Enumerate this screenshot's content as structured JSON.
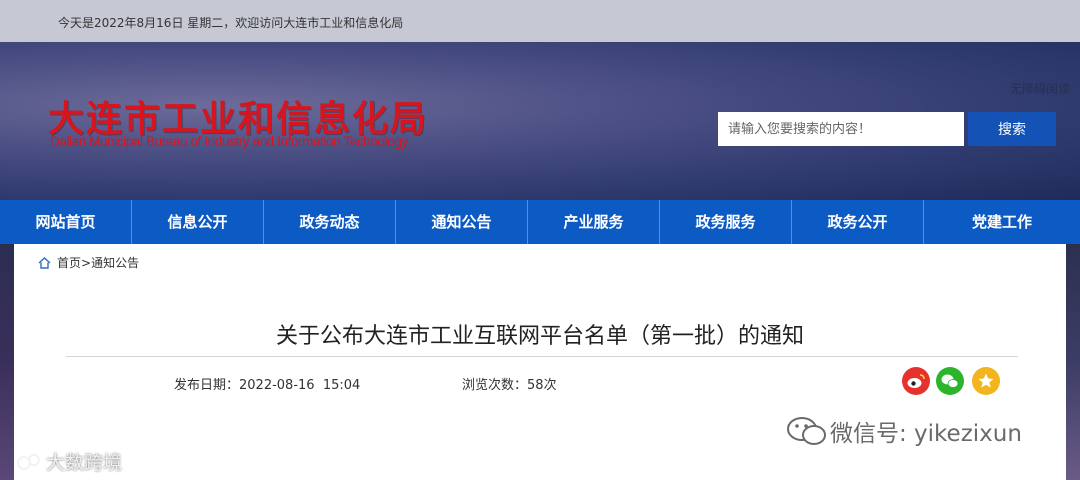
{
  "topbar": {
    "date_text": "今天是2022年8月16日 星期二，欢迎访问大连市工业和信息化局"
  },
  "header": {
    "logo_cn": "大连市工业和信息化局",
    "logo_en": "Dalian Municipal Bureau of Industry and Information Technology",
    "accessibility_label": "无障碍阅读",
    "search": {
      "placeholder": "请输入您要搜索的内容！",
      "value": "",
      "button_label": "搜索"
    },
    "brand_color": "#d8141c"
  },
  "nav": {
    "color": "#0c5ac4",
    "items": [
      "网站首页",
      "信息公开",
      "政务动态",
      "通知公告",
      "产业服务",
      "政务服务",
      "政务公开",
      "党建工作"
    ]
  },
  "breadcrumb": {
    "home": "首页",
    "separator": ">",
    "current": "通知公告"
  },
  "article": {
    "title": "关于公布大连市工业互联网平台名单（第一批）的通知",
    "publish_label": "发布日期：",
    "publish_date": "2022-08-16  15:04",
    "views_label": "浏览次数：",
    "views_count": "58",
    "views_unit": "次"
  },
  "share": {
    "weibo_color": "#e5322d",
    "wechat_color": "#2bb52b",
    "favorite_color": "#f2b51e"
  },
  "watermarks": {
    "left": "大数跨境",
    "right": "微信号: yikezixun"
  }
}
